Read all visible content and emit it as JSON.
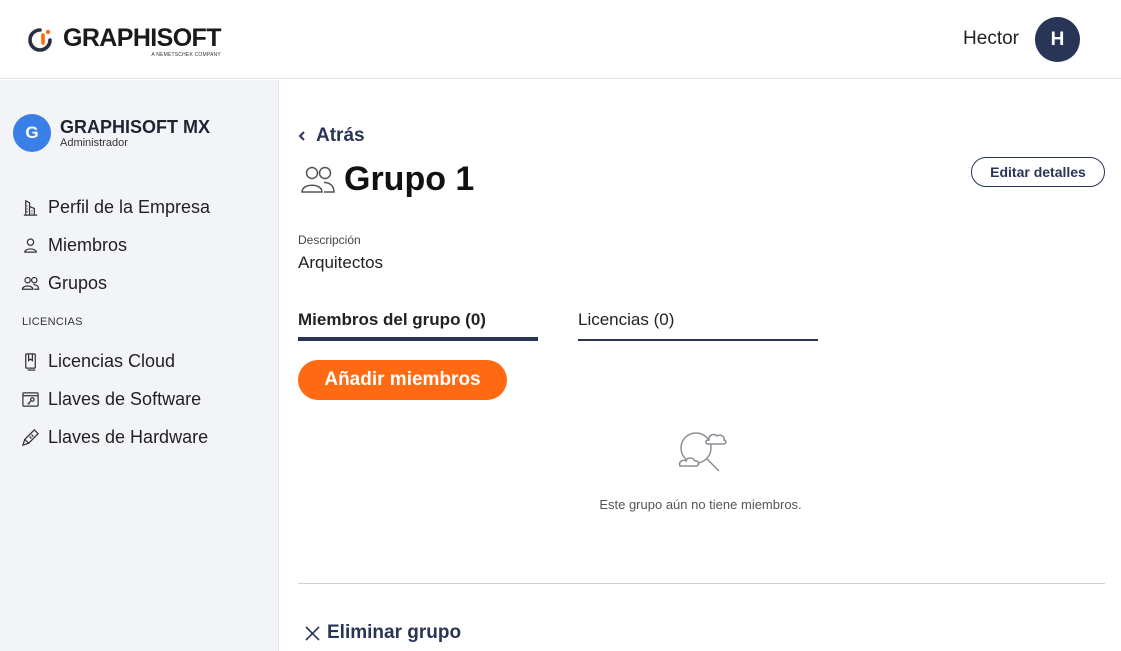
{
  "header": {
    "logo_text": "GRAPHISOFT",
    "logo_subtext": "A NEMETSCHEK COMPANY",
    "user_name": "Hector",
    "user_initial": "H"
  },
  "sidebar": {
    "org": {
      "initial": "G",
      "name": "GRAPHISOFT MX",
      "role": "Administrador"
    },
    "items": [
      {
        "label": "Perfil de la Empresa",
        "icon": "building-icon"
      },
      {
        "label": "Miembros",
        "icon": "person-icon"
      },
      {
        "label": "Grupos",
        "icon": "group-icon"
      }
    ],
    "section_label": "LICENCIAS",
    "license_items": [
      {
        "label": "Licencias Cloud",
        "icon": "cloud-license-icon"
      },
      {
        "label": "Llaves de Software",
        "icon": "software-key-icon"
      },
      {
        "label": "Llaves de Hardware",
        "icon": "hardware-key-icon"
      }
    ]
  },
  "main": {
    "back_label": "Atrás",
    "title": "Grupo 1",
    "edit_button": "Editar detalles",
    "description_label": "Descripción",
    "description_value": "Arquitectos",
    "tabs": [
      {
        "label": "Miembros del grupo (0)",
        "active": true
      },
      {
        "label": "Licencias (0)",
        "active": false
      }
    ],
    "add_button": "Añadir miembros",
    "empty_message": "Este grupo aún no tiene miembros.",
    "delete_label": "Eliminar grupo"
  },
  "colors": {
    "accent": "#ff6a13",
    "navy": "#283557",
    "org_avatar": "#3a7fe6",
    "sidebar_bg": "#f3f4f8"
  }
}
